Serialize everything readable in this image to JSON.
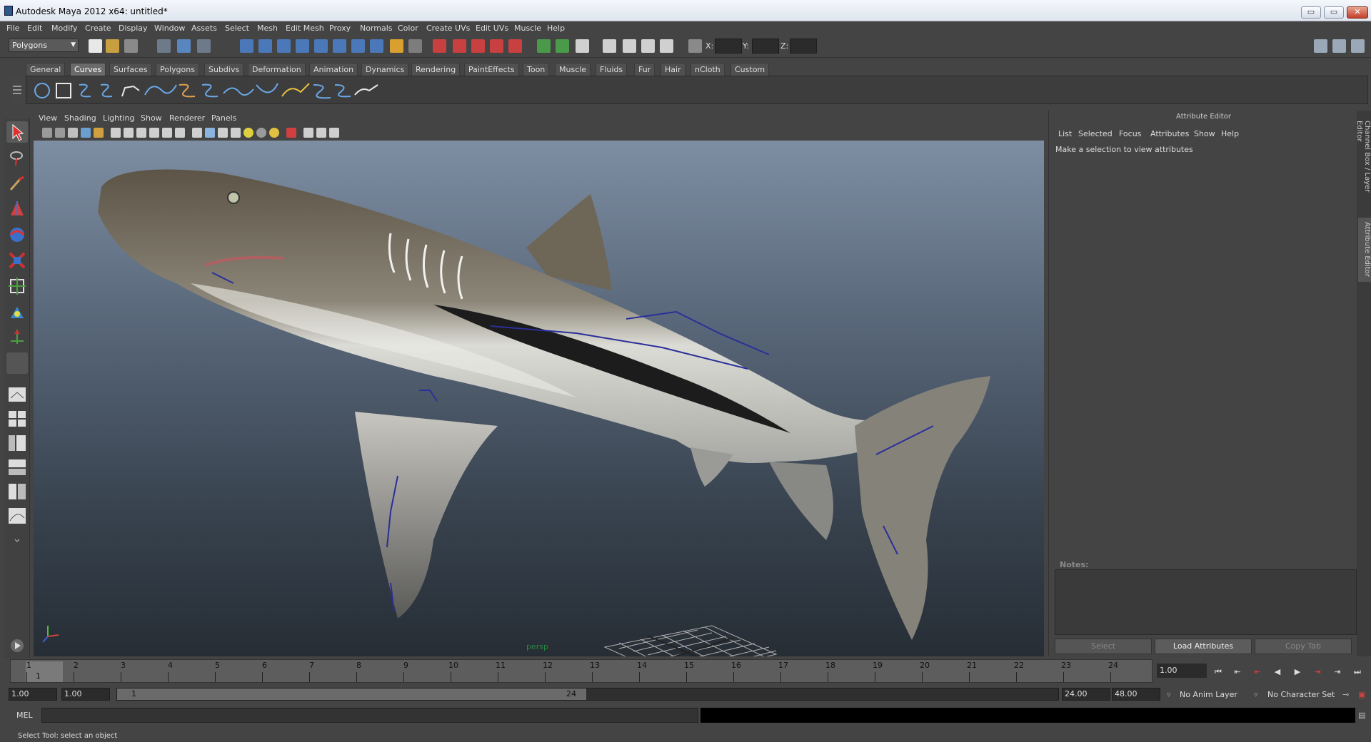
{
  "window": {
    "title": "Autodesk Maya 2012 x64: untitled*",
    "minimize": "▭",
    "maximize": "▭",
    "close": "✕"
  },
  "menubar": [
    "File",
    "Edit",
    "Modify",
    "Create",
    "Display",
    "Window",
    "Assets",
    "Select",
    "Mesh",
    "Edit Mesh",
    "Proxy",
    "Normals",
    "Color",
    "Create UVs",
    "Edit UVs",
    "Muscle",
    "Help"
  ],
  "statusline": {
    "mode": "Polygons",
    "x_label": "X:",
    "y_label": "Y:",
    "z_label": "Z:"
  },
  "shelf_tabs": [
    "General",
    "Curves",
    "Surfaces",
    "Polygons",
    "Subdivs",
    "Deformation",
    "Animation",
    "Dynamics",
    "Rendering",
    "PaintEffects",
    "Toon",
    "Muscle",
    "Fluids",
    "Fur",
    "Hair",
    "nCloth",
    "Custom"
  ],
  "shelf_active": "Curves",
  "panel_menu": [
    "View",
    "Shading",
    "Lighting",
    "Show",
    "Renderer",
    "Panels"
  ],
  "viewport": {
    "camera": "persp",
    "colors": {
      "shark_top": "#5c5446",
      "shark_belly": "#dcdcd6",
      "rig": "#2a2f9a",
      "grid": "#aaaaaa"
    }
  },
  "attribute_editor": {
    "title": "Attribute Editor",
    "menu": [
      "List",
      "Selected",
      "Focus",
      "Attributes",
      "Show",
      "Help"
    ],
    "message": "Make a selection to view attributes",
    "notes_label": "Notes:",
    "buttons": {
      "select": "Select",
      "load": "Load Attributes",
      "copy": "Copy Tab"
    }
  },
  "side_tabs": {
    "channel_box": "Channel Box / Layer Editor",
    "attribute_editor": "Attribute Editor"
  },
  "timeline": {
    "ticks": [
      "1",
      "2",
      "3",
      "4",
      "5",
      "6",
      "7",
      "8",
      "9",
      "10",
      "11",
      "12",
      "13",
      "14",
      "15",
      "16",
      "17",
      "18",
      "19",
      "20",
      "21",
      "22",
      "23",
      "24"
    ],
    "current_frame": "1",
    "current_frame_field": "1.00"
  },
  "range": {
    "start": "1.00",
    "playback_start": "1.00",
    "handle_start": "1",
    "handle_end": "24",
    "playback_end": "24.00",
    "end": "48.00",
    "anim_layer": "No Anim Layer",
    "character_set": "No Character Set"
  },
  "command": {
    "mel_label": "MEL"
  },
  "help_line": "Select Tool: select an object"
}
